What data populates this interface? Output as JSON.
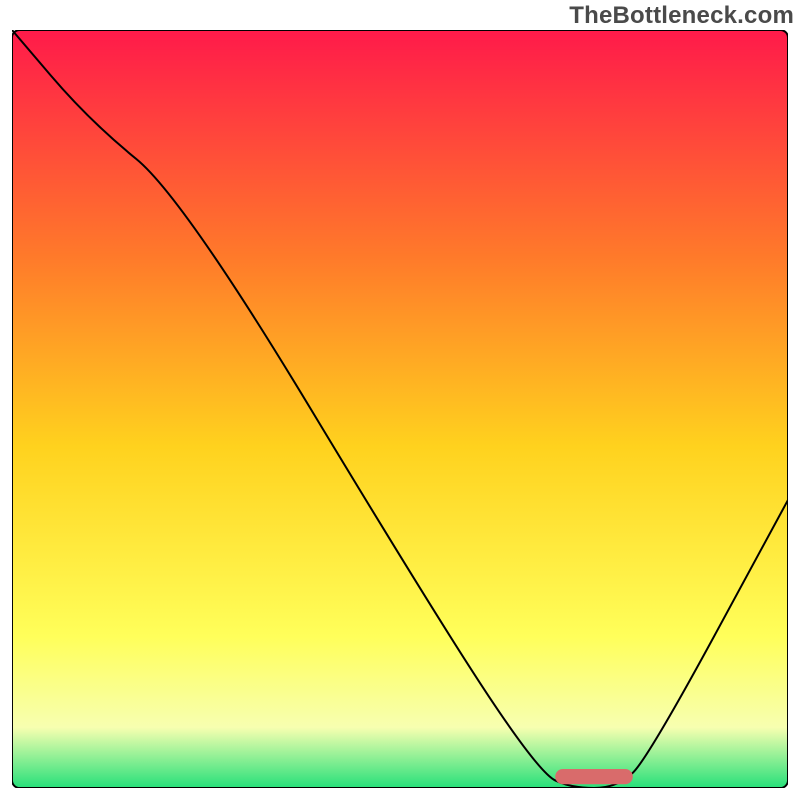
{
  "watermark": "TheBottleneck.com",
  "colors": {
    "gradient_top": "#ff1a4a",
    "gradient_mid_upper": "#ff7a2a",
    "gradient_mid": "#ffd21e",
    "gradient_mid_lower": "#ffff5a",
    "gradient_lower": "#f7ffb0",
    "gradient_bottom": "#26e07a",
    "curve_stroke": "#000000",
    "bar_fill": "#d96b6b",
    "plot_border": "#000000"
  },
  "chart_data": {
    "type": "line",
    "title": "",
    "xlabel": "",
    "ylabel": "",
    "xlim": [
      0,
      100
    ],
    "ylim": [
      0,
      100
    ],
    "series": [
      {
        "name": "bottleneck-curve",
        "x": [
          0,
          10,
          22,
          55,
          68,
          72,
          78,
          82,
          100
        ],
        "values": [
          100,
          88,
          78,
          22,
          2,
          0,
          0,
          4,
          38
        ]
      }
    ],
    "marker": {
      "name": "optimal-range-bar",
      "x_start": 70,
      "x_end": 80,
      "y": 1.5,
      "height": 2
    },
    "gradient_stops": [
      {
        "offset": 0.0,
        "color": "#ff1a4a"
      },
      {
        "offset": 0.3,
        "color": "#ff7a2a"
      },
      {
        "offset": 0.55,
        "color": "#ffd21e"
      },
      {
        "offset": 0.8,
        "color": "#ffff5a"
      },
      {
        "offset": 0.92,
        "color": "#f7ffb0"
      },
      {
        "offset": 1.0,
        "color": "#26e07a"
      }
    ]
  }
}
